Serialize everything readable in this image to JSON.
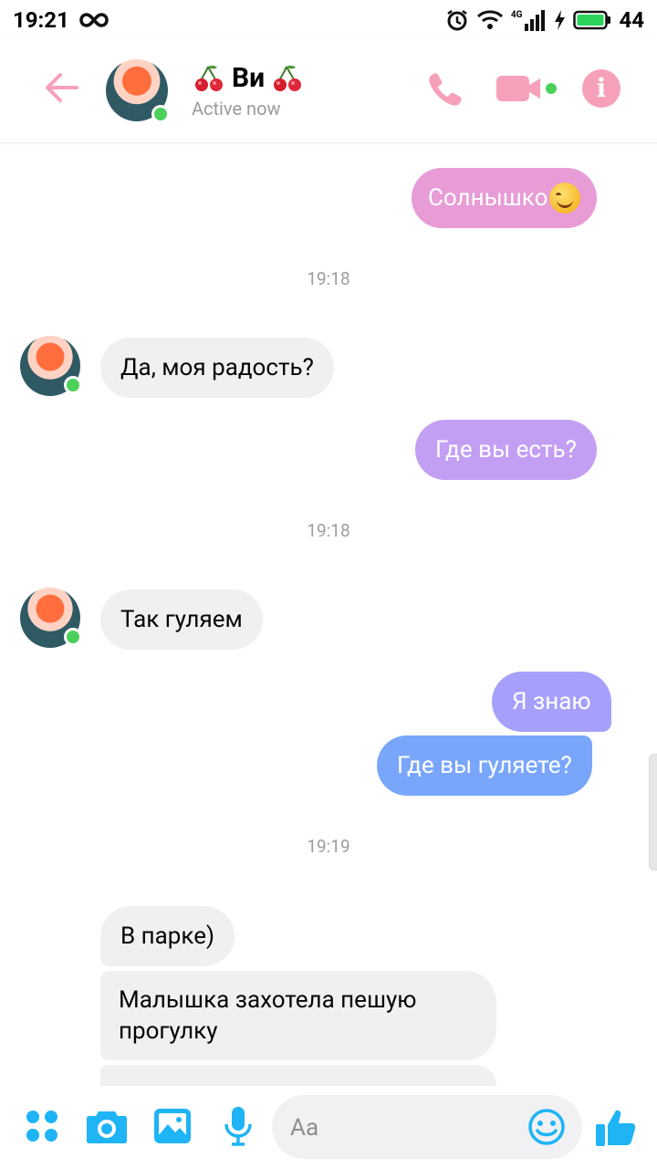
{
  "status_bar": {
    "time": "19:21",
    "network": "4G",
    "battery": "44"
  },
  "header": {
    "title": "Ви",
    "status": "Active now"
  },
  "messages": [
    {
      "type": "sent",
      "text": "Солнышко"
    },
    {
      "type": "time",
      "text": "19:18"
    },
    {
      "type": "received",
      "text": "Да,  моя радость?"
    },
    {
      "type": "sent",
      "text": "Где вы есть?"
    },
    {
      "type": "time",
      "text": "19:18"
    },
    {
      "type": "received",
      "text": "Так гуляем"
    },
    {
      "type": "sent",
      "text": "Я знаю"
    },
    {
      "type": "sent",
      "text": "Где вы гуляете?"
    },
    {
      "type": "time",
      "text": "19:19"
    },
    {
      "type": "received",
      "text": "В парке)"
    },
    {
      "type": "received",
      "text": "Малышка захотела пешую прогулку"
    }
  ],
  "composer": {
    "placeholder": "Aa"
  },
  "colors": {
    "accent_pink": "#f6a1b9",
    "bubble_pink": "#e79cd6",
    "bubble_violet": "#c39ff4",
    "bubble_periwinkle": "#a6a0fb",
    "bubble_blue": "#79a6fb",
    "received_bg": "#f0f0f3",
    "footer_icon_blue": "#1eb4f6",
    "online_green": "#4bd05b"
  }
}
